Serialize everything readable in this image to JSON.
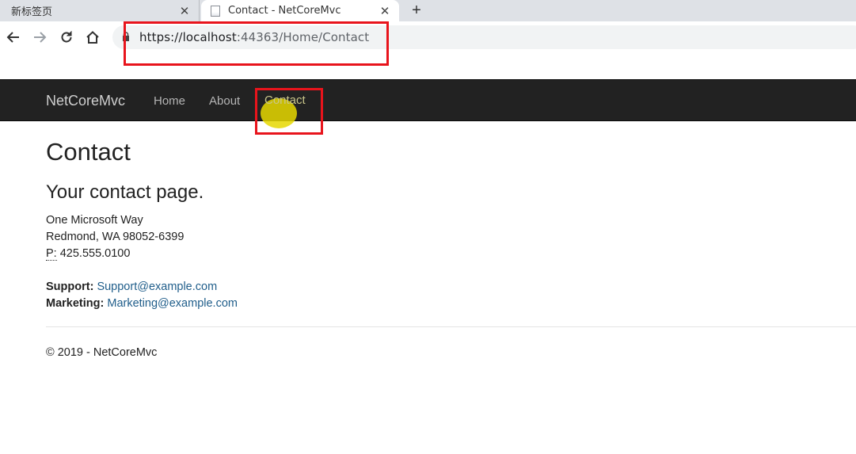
{
  "browser": {
    "tabs": [
      {
        "title": "新标签页",
        "close": "✕"
      },
      {
        "title": "Contact - NetCoreMvc",
        "close": "✕"
      }
    ],
    "new_tab": "+",
    "url_host": "https://localhost",
    "url_rest": ":44363/Home/Contact"
  },
  "navbar": {
    "brand": "NetCoreMvc",
    "links": [
      "Home",
      "About",
      "Contact"
    ]
  },
  "page": {
    "title": "Contact",
    "subtitle": "Your contact page.",
    "address_line1": "One Microsoft Way",
    "address_line2": "Redmond, WA 98052-6399",
    "phone_label": "P:",
    "phone": " 425.555.0100",
    "support_label": "Support:",
    "support_email": "Support@example.com",
    "marketing_label": "Marketing:",
    "marketing_email": "Marketing@example.com"
  },
  "footer": {
    "text": "© 2019 - NetCoreMvc"
  },
  "colors": {
    "highlight": "#e8141c",
    "navbar_bg": "#222222",
    "link": "#1f5d8a",
    "cursor": "#e6d800"
  }
}
